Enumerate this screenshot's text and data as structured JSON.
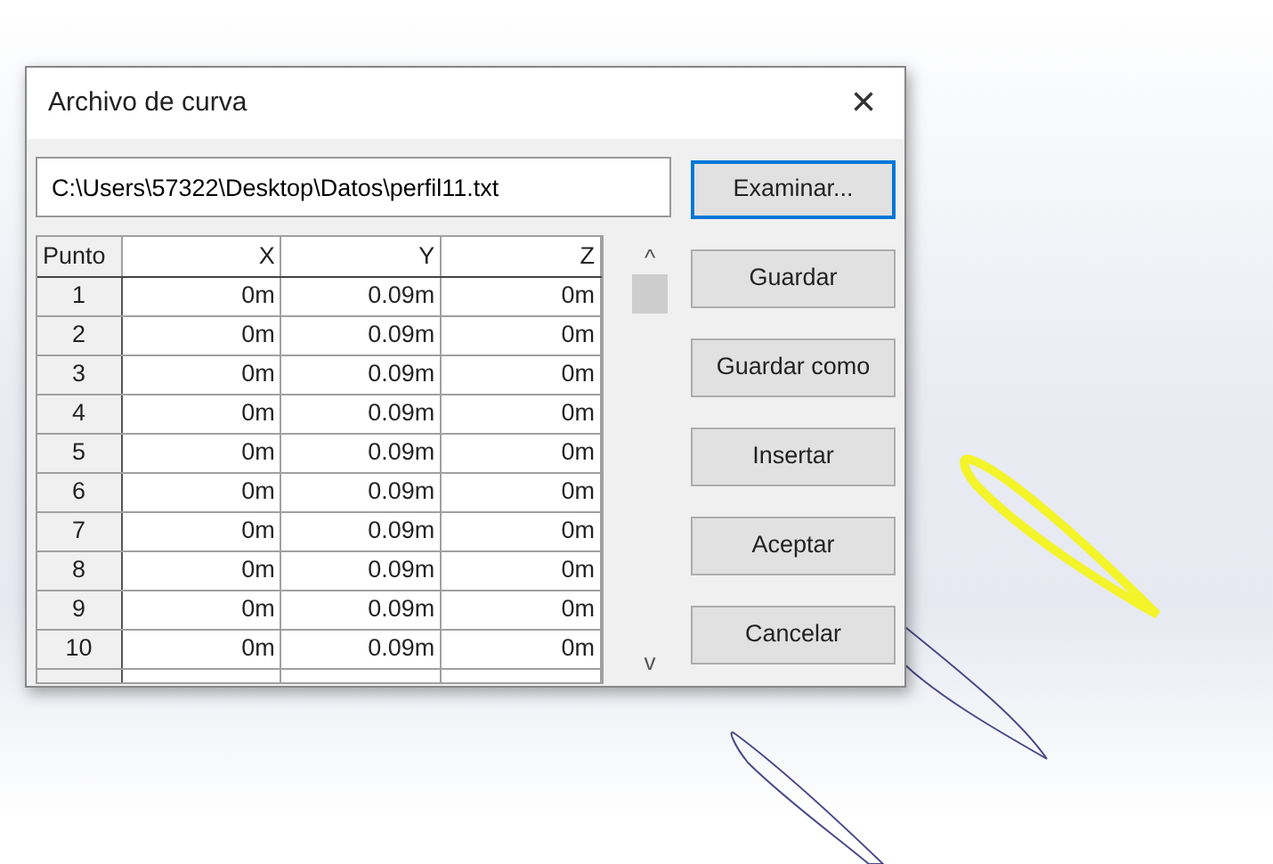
{
  "window": {
    "title": "Archivo de curva",
    "close": "×"
  },
  "file_path": {
    "value": "C:\\Users\\57322\\Desktop\\Datos\\perfil11.txt"
  },
  "browse_button": "Examinar...",
  "table": {
    "columns": [
      "Punto",
      "X",
      "Y",
      "Z"
    ],
    "rows": [
      [
        "1",
        "0m",
        "0.09m",
        "0m"
      ],
      [
        "2",
        "0m",
        "0.09m",
        "0m"
      ],
      [
        "3",
        "0m",
        "0.09m",
        "0m"
      ],
      [
        "4",
        "0m",
        "0.09m",
        "0m"
      ],
      [
        "5",
        "0m",
        "0.09m",
        "0m"
      ],
      [
        "6",
        "0m",
        "0.09m",
        "0m"
      ],
      [
        "7",
        "0m",
        "0.09m",
        "0m"
      ],
      [
        "8",
        "0m",
        "0.09m",
        "0m"
      ],
      [
        "9",
        "0m",
        "0.09m",
        "0m"
      ],
      [
        "10",
        "0m",
        "0.09m",
        "0m"
      ]
    ]
  },
  "scrollbar": {
    "up": "^",
    "down": "v"
  },
  "buttons": [
    "Guardar",
    "Guardar como",
    "Insertar",
    "Aceptar",
    "Cancelar"
  ]
}
